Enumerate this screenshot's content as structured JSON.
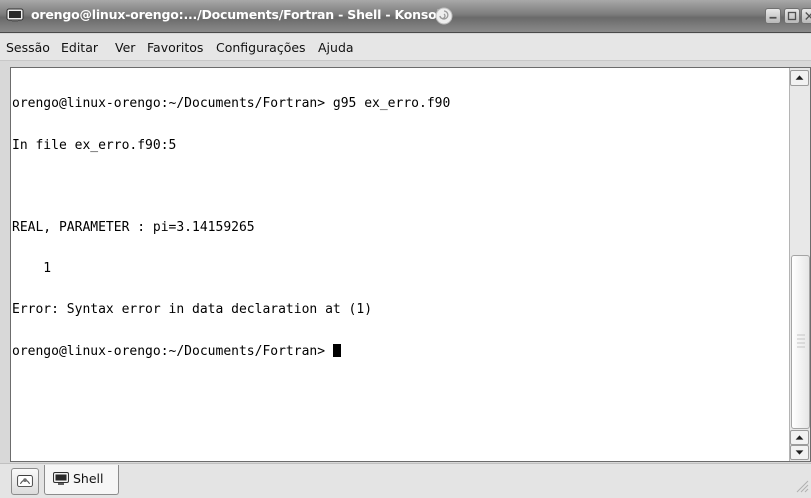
{
  "window": {
    "title": "orengo@linux-orengo:.../Documents/Fortran - Shell - Konsole",
    "titlebar_color": "#7c7c7c",
    "title_text_color": "#ffffff"
  },
  "menu": {
    "items": [
      "Sessão",
      "Editar",
      "Ver",
      "Favoritos",
      "Configurações",
      "Ajuda"
    ]
  },
  "terminal": {
    "background": "#ffffff",
    "foreground": "#000000",
    "lines": [
      "orengo@linux-orengo:~/Documents/Fortran> g95 ex_erro.f90",
      "In file ex_erro.f90:5",
      "",
      "REAL, PARAMETER : pi=3.14159265",
      "    1",
      "Error: Syntax error in data declaration at (1)",
      "orengo@linux-orengo:~/Documents/Fortran> "
    ]
  },
  "tabs": [
    {
      "label": "Shell",
      "icon": "terminal-icon",
      "active": true
    }
  ],
  "icons": {
    "app": "konsole-icon",
    "title_decoration": "swirl-icon",
    "new_session": "new-session-icon",
    "minimize": "minimize-icon",
    "maximize": "maximize-icon",
    "close": "close-icon",
    "resize": "resize-grip-icon"
  }
}
